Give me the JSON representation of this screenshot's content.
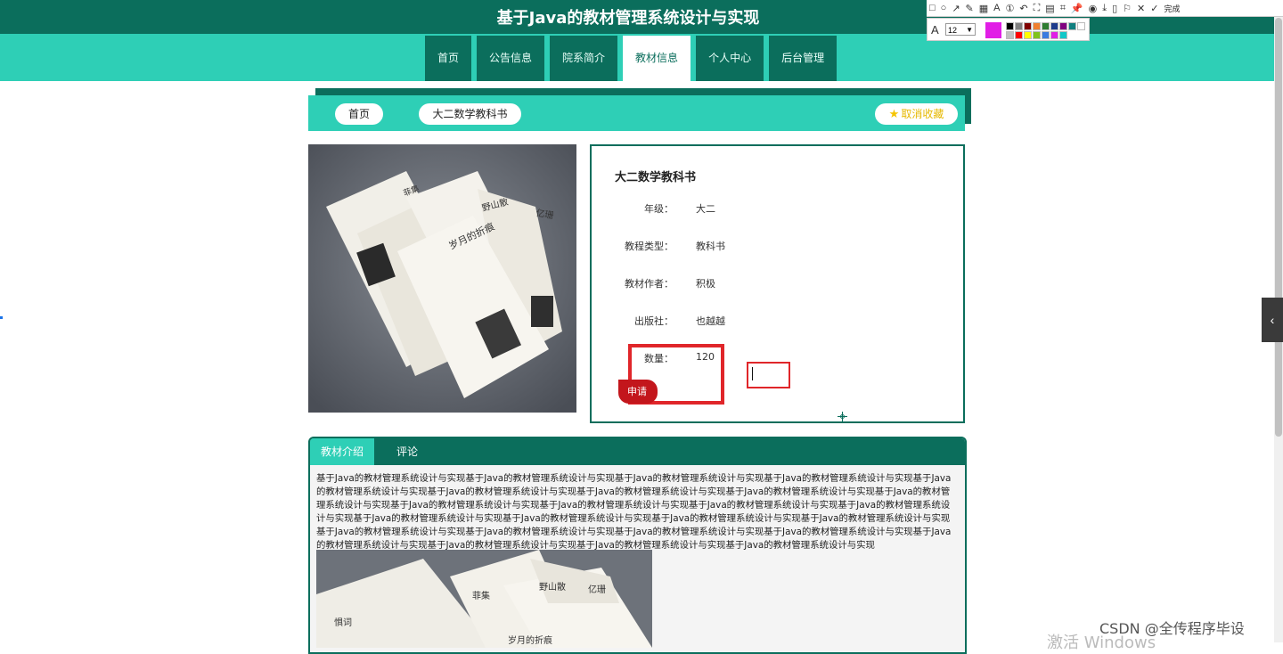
{
  "site": {
    "title": "基于Java的教材管理系统设计与实现"
  },
  "nav": {
    "items": [
      "首页",
      "公告信息",
      "院系简介",
      "教材信息",
      "个人中心",
      "后台管理"
    ],
    "active_index": 3
  },
  "breadcrumb": {
    "home": "首页",
    "current": "大二数学教科书",
    "favorite_label": "取消收藏"
  },
  "book": {
    "title": "大二数学教科书",
    "fields": [
      {
        "label": "年级：",
        "value": "大二"
      },
      {
        "label": "教程类型：",
        "value": "教科书"
      },
      {
        "label": "教材作者：",
        "value": "积极"
      },
      {
        "label": "出版社：",
        "value": "也越越"
      },
      {
        "label": "数量：",
        "value": "120"
      }
    ],
    "apply_label": "申请"
  },
  "tabs": {
    "items": [
      "教材介绍",
      "评论"
    ],
    "active_index": 0
  },
  "intro": {
    "text": "基于Java的教材管理系统设计与实现基于Java的教材管理系统设计与实现基于Java的教材管理系统设计与实现基于Java的教材管理系统设计与实现基于Java的教材管理系统设计与实现基于Java的教材管理系统设计与实现基于Java的教材管理系统设计与实现基于Java的教材管理系统设计与实现基于Java的教材管理系统设计与实现基于Java的教材管理系统设计与实现基于Java的教材管理系统设计与实现基于Java的教材管理系统设计与实现基于Java的教材管理系统设计与实现基于Java的教材管理系统设计与实现基于Java的教材管理系统设计与实现基于Java的教材管理系统设计与实现基于Java的教材管理系统设计与实现基于Java的教材管理系统设计与实现基于Java的教材管理系统设计与实现基于Java的教材管理系统设计与实现基于Java的教材管理系统设计与实现基于Java的教材管理系统设计与实现基于Java的教材管理系统设计与实现基于Java的教材管理系统设计与实现基于Java的教材管理系统设计与实现"
  },
  "photo_titles": {
    "main": "岁月的折痕",
    "side_a": "野山散",
    "side_b": "亿珊",
    "side_c": "菲集",
    "side_d": "惧词"
  },
  "snip_tool": {
    "done_label": "完成",
    "font_size": "12",
    "current_color": "#e11ee6",
    "palette": [
      "#000000",
      "#808080",
      "#800000",
      "#f08030",
      "#2e7d32",
      "#1e3c8c",
      "#800080",
      "#108080",
      "#ffffff",
      "#c0c0c0",
      "#ff0000",
      "#ffff00",
      "#7fc31c",
      "#3a7be0",
      "#e11ee6",
      "#10c8c8"
    ]
  },
  "overlay": {
    "watermark": "CSDN @全传程序毕设",
    "windows": "激活 Windows"
  },
  "colors": {
    "primary": "#0b6e5c",
    "accent": "#2ecfb6",
    "danger": "#c3161c"
  }
}
